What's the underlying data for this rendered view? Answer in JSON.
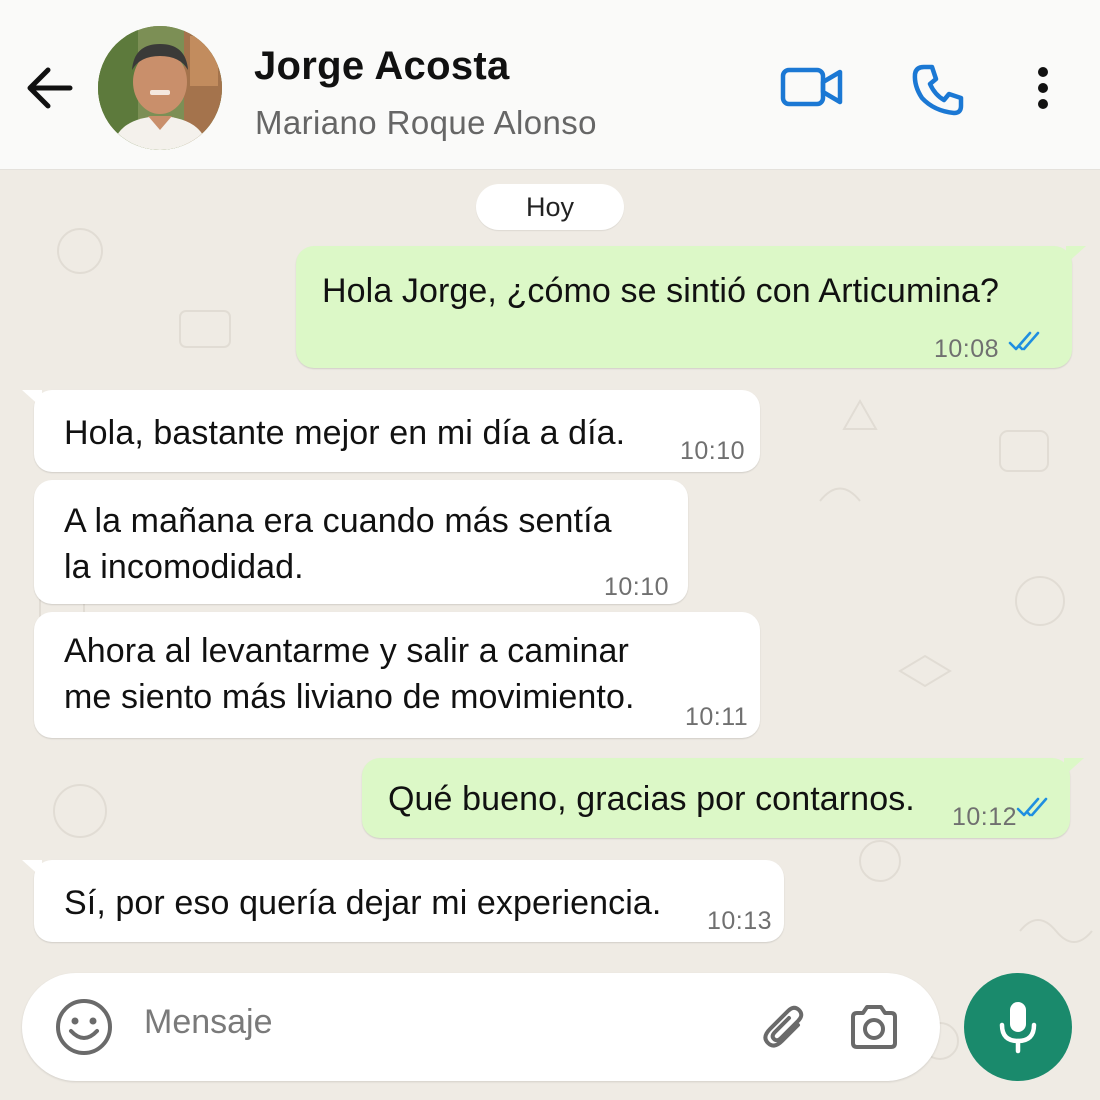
{
  "header": {
    "contact_name": "Jorge Acosta",
    "contact_subtitle": "Mariano Roque Alonso",
    "icons": [
      "back-arrow-icon",
      "video-call-icon",
      "phone-call-icon",
      "more-vert-icon"
    ],
    "accent_color": "#1b78d4"
  },
  "chat": {
    "date_label": "Hoy",
    "messages": [
      {
        "direction": "out",
        "lines": [
          "Hola Jorge, ¿cómo se sintió con Articumina?"
        ],
        "time": "10:08",
        "read": true
      },
      {
        "direction": "in",
        "lines": [
          "Hola, bastante mejor en mi día a día."
        ],
        "time": "10:10"
      },
      {
        "direction": "in",
        "lines": [
          "A la mañana era cuando más sentía",
          "la incomodidad."
        ],
        "time": "10:10"
      },
      {
        "direction": "in",
        "lines": [
          "Ahora al levantarme y salir a caminar",
          "me siento más liviano de movimiento."
        ],
        "time": "10:11"
      },
      {
        "direction": "out",
        "lines": [
          "Qué bueno, gracias por contarnos."
        ],
        "time": "10:12",
        "read": true
      },
      {
        "direction": "in",
        "lines": [
          "Sí, por eso quería dejar mi experiencia."
        ],
        "time": "10:13"
      }
    ],
    "colors": {
      "incoming": "#ffffff",
      "outgoing": "#dcf8c7",
      "read_ticks": "#1f8fe0"
    }
  },
  "composer": {
    "placeholder": "Mensaje",
    "icons": [
      "emoji-icon",
      "attach-icon",
      "camera-icon",
      "mic-icon"
    ],
    "mic_color": "#1a8a6c"
  }
}
